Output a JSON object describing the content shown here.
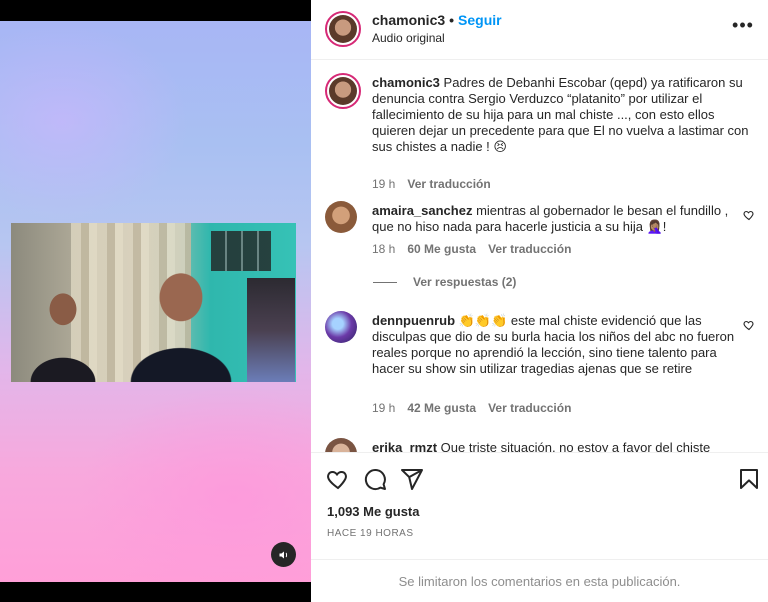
{
  "post": {
    "username": "chamonic3",
    "separator": "•",
    "follow_label": "Seguir",
    "audio_label": "Audio original",
    "more_label": "•••"
  },
  "caption": {
    "username": "chamonic3",
    "text": "Padres de Debanhi Escobar (qepd) ya ratificaron su denuncia contra Sergio Verduzco “platanito” por utilizar el fallecimiento de su hija para un mal chiste ..., con esto ellos quieren dejar un precedente para que El no vuelva a lastimar con sus chistes a nadie ! 😣",
    "time": "19 h",
    "translate": "Ver traducción"
  },
  "comments": [
    {
      "username": "amaira_sanchez",
      "text": "mientras al gobernador le besan el fundillo , que no hiso nada para hacerle justicia a su hija 🤦🏽‍♀️!",
      "time": "18 h",
      "likes": "60 Me gusta",
      "translate": "Ver traducción",
      "replies": "Ver respuestas (2)"
    },
    {
      "username": "dennpuenrub",
      "text": "👏👏👏 este mal chiste evidenció que las disculpas que dio de su burla hacia los niños del abc no fueron reales porque no aprendió la lección, sino tiene talento para hacer su show sin utilizar tragedias ajenas que se retire",
      "time": "19 h",
      "likes": "42 Me gusta",
      "translate": "Ver traducción"
    },
    {
      "username": "erika_rmzt",
      "text": "Que triste situación, no estoy a favor del chiste"
    }
  ],
  "footer": {
    "likes": "1,093 Me gusta",
    "posted": "HACE 19 HORAS",
    "comments_limited": "Se limitaron los comentarios en esta publicación."
  },
  "icons": {
    "heart": "heart-icon",
    "comment": "comment-icon",
    "share": "share-icon",
    "save": "bookmark-icon",
    "sound": "sound-icon"
  },
  "colors": {
    "accent": "#0095f6",
    "text": "#262626",
    "muted": "#737373"
  }
}
